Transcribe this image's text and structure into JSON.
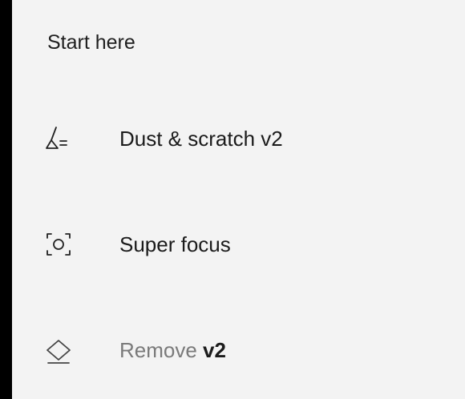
{
  "section": {
    "title": "Start here"
  },
  "items": [
    {
      "label": "Dust & scratch v2",
      "icon": "broom-icon"
    },
    {
      "label": "Super focus",
      "icon": "focus-icon"
    },
    {
      "label": "Remove",
      "badge": "v2",
      "icon": "eraser-icon",
      "label_color": "#7a7a7a"
    }
  ]
}
